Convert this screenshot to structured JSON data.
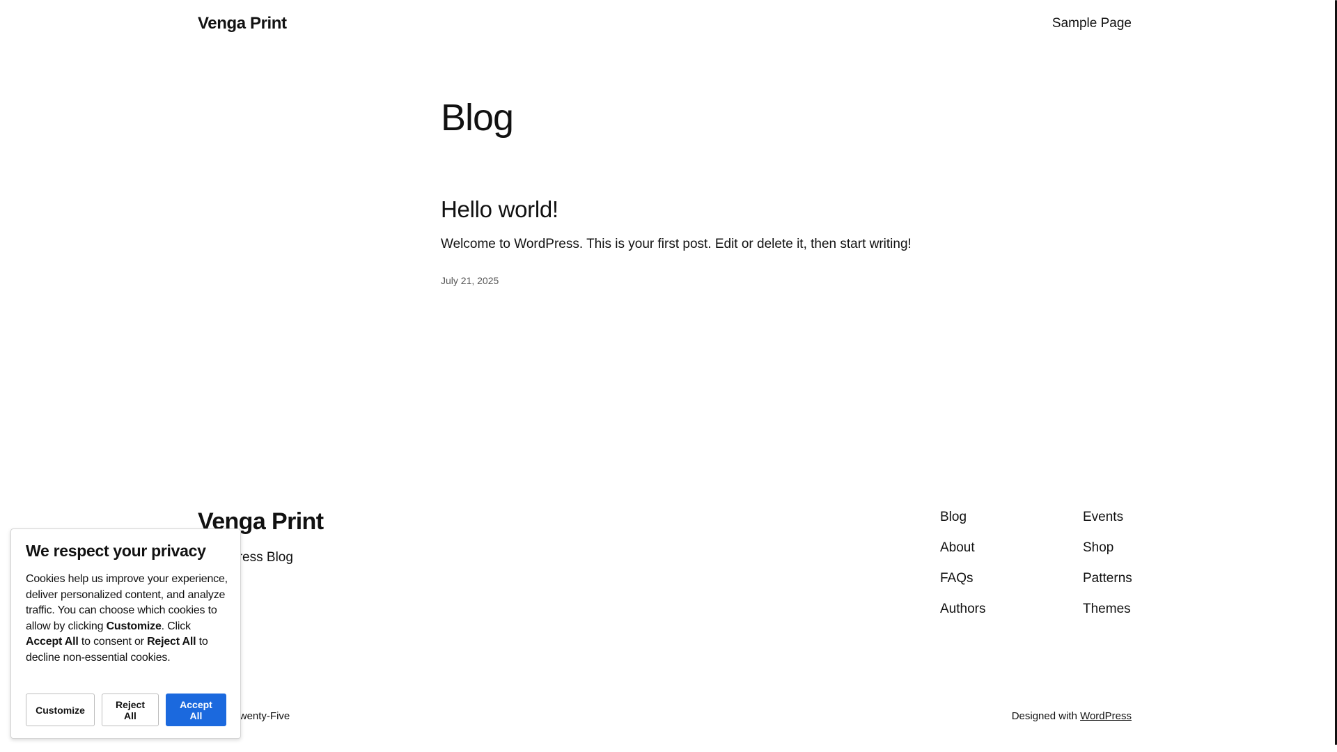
{
  "header": {
    "site_title": "Venga Print",
    "nav": [
      {
        "label": "Sample Page"
      }
    ]
  },
  "main": {
    "page_title": "Blog",
    "posts": [
      {
        "title": "Hello world!",
        "excerpt": "Welcome to WordPress. This is your first post. Edit or delete it, then start writing!",
        "date": "July 21, 2025"
      }
    ]
  },
  "footer": {
    "site_title": "Venga Print",
    "tagline": "WordPress Blog",
    "nav_col1": [
      {
        "label": "Blog"
      },
      {
        "label": "About"
      },
      {
        "label": "FAQs"
      },
      {
        "label": "Authors"
      }
    ],
    "nav_col2": [
      {
        "label": "Events"
      },
      {
        "label": "Shop"
      },
      {
        "label": "Patterns"
      },
      {
        "label": "Themes"
      }
    ],
    "theme_name": "Twenty Twenty-Five",
    "credit_prefix": "Designed with",
    "credit_link": "WordPress"
  },
  "cookie": {
    "heading": "We respect your privacy",
    "text_1": "Cookies help us improve your experience, deliver personalized content, and analyze traffic. You can choose which cookies to allow by clicking ",
    "customize_word": "Customize",
    "text_2": ". Click ",
    "accept_word": "Accept All",
    "text_3": " to consent or ",
    "reject_word": "Reject All",
    "text_4": " to decline non-essential cookies.",
    "buttons": {
      "customize": "Customize",
      "reject": "Reject All",
      "accept": "Accept All"
    },
    "accent_color": "#1b69de"
  }
}
